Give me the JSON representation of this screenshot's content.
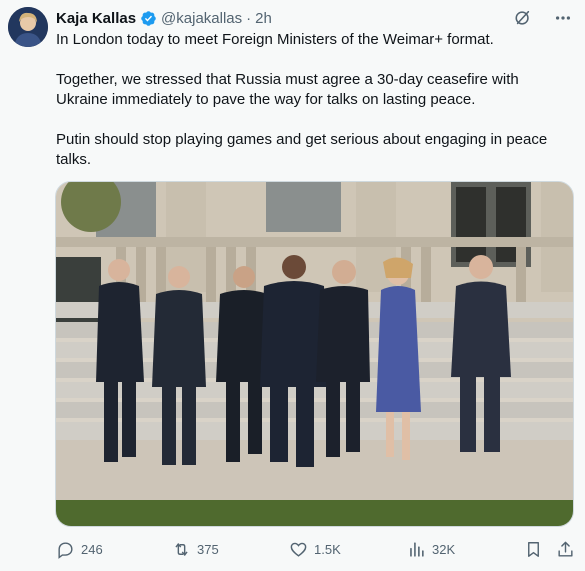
{
  "author": {
    "name": "Kaja Kallas",
    "handle": "@kajakallas",
    "separator": "·",
    "time": "2h",
    "verified_color": "#1d9bf0"
  },
  "icons": {
    "more": "grok-icon",
    "menu": "more-icon"
  },
  "tweet": {
    "paragraphs": [
      "In London today to meet Foreign Ministers of the Weimar+ format.",
      "Together, we stressed that Russia must agree a 30-day ceasefire with Ukraine immediately to pave the way for talks on lasting peace.",
      "Putin should stop playing games and get serious about engaging in peace talks."
    ]
  },
  "metrics": {
    "replies": "246",
    "retweets": "375",
    "likes": "1.5K",
    "views": "32K"
  },
  "colors": {
    "text": "#0f1419",
    "muted": "#536471",
    "accent": "#1d9bf0"
  }
}
